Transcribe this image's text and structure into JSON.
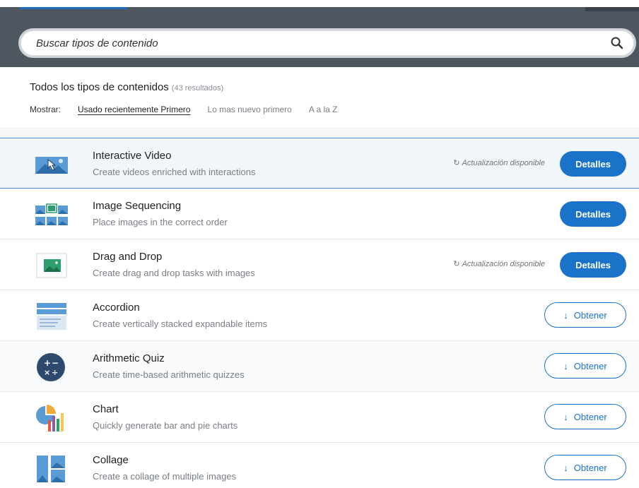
{
  "search": {
    "placeholder": "Buscar tipos de contenido"
  },
  "filter": {
    "heading": "Todos los tipos de contenidos",
    "result_count": "(43 resultados)",
    "show_label": "Mostrar:",
    "sort_options": [
      "Usado recientemente Primero",
      "Lo mas nuevo primero",
      "A a la Z"
    ],
    "active_sort": "Usado recientemente Primero"
  },
  "items": [
    {
      "title": "Interactive Video",
      "description": "Create videos enriched with interactions",
      "icon": "interactive-video-icon",
      "update": "Actualización disponible",
      "action": "Detalles"
    },
    {
      "title": "Image Sequencing",
      "description": "Place images in the correct order",
      "icon": "image-sequencing-icon",
      "update": "",
      "action": "Detalles"
    },
    {
      "title": "Drag and Drop",
      "description": "Create drag and drop tasks with images",
      "icon": "drag-and-drop-icon",
      "update": "Actualización disponible",
      "action": "Detalles"
    },
    {
      "title": "Accordion",
      "description": "Create vertically stacked expandable items",
      "icon": "accordion-icon",
      "update": "",
      "action": "Obtener"
    },
    {
      "title": "Arithmetic Quiz",
      "description": "Create time-based arithmetic quizzes",
      "icon": "arithmetic-quiz-icon",
      "update": "",
      "action": "Obtener"
    },
    {
      "title": "Chart",
      "description": "Quickly generate bar and pie charts",
      "icon": "chart-icon",
      "update": "",
      "action": "Obtener"
    },
    {
      "title": "Collage",
      "description": "Create a collage of multiple images",
      "icon": "collage-icon",
      "update": "",
      "action": "Obtener"
    }
  ],
  "colors": {
    "header_bg": "#4e5660",
    "accent": "#1a73c8",
    "highlight_border": "#4a90d0"
  }
}
